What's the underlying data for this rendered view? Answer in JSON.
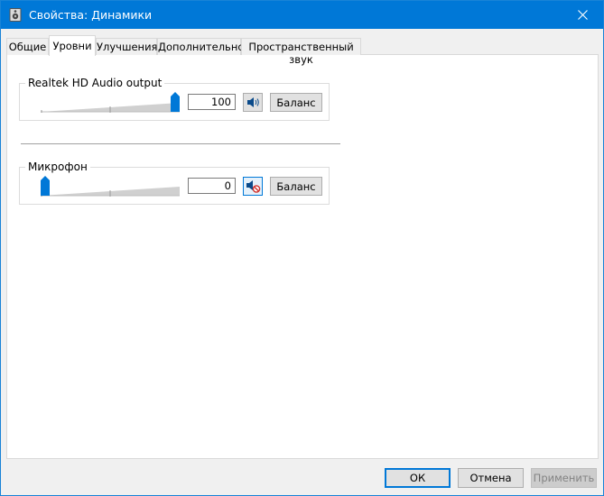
{
  "window": {
    "title": "Свойства: Динамики",
    "accent": "#0078d7"
  },
  "tabs": [
    {
      "label": "Общие",
      "active": false
    },
    {
      "label": "Уровни",
      "active": true
    },
    {
      "label": "Улучшения",
      "active": false
    },
    {
      "label": "Дополнительно",
      "active": false
    },
    {
      "label": "Пространственный звук",
      "active": false
    }
  ],
  "levels": {
    "output": {
      "label": "Realtek HD Audio output",
      "value": "100",
      "slider_level": 1.0,
      "muted": false,
      "balance_label": "Баланс"
    },
    "microphone": {
      "label": "Микрофон",
      "value": "0",
      "slider_level": 0.0,
      "muted": true,
      "balance_label": "Баланс"
    }
  },
  "footer": {
    "ok_label": "ОК",
    "cancel_label": "Отмена",
    "apply_label": "Применить"
  }
}
